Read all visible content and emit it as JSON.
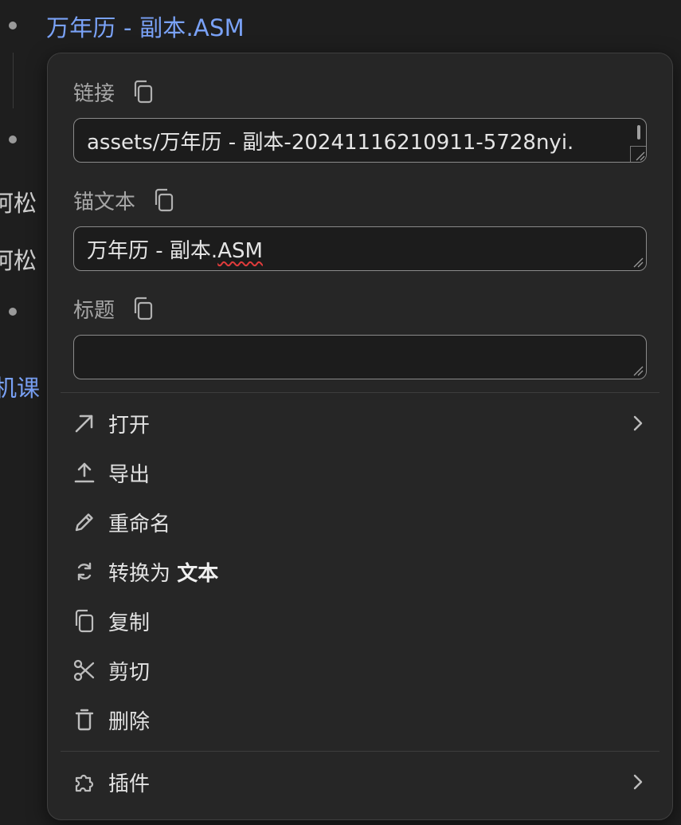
{
  "background": {
    "link_text": "万年历 - 副本.ASM",
    "text_line_1": "呵松",
    "text_line_2": "呵松",
    "text_line_3": "机课"
  },
  "menu": {
    "link_field": {
      "label": "链接",
      "value": "assets/万年历 - 副本-20241116210911-5728nyi."
    },
    "anchor_field": {
      "label": "锚文本",
      "value_prefix": "万年历 - 副本.",
      "value_misspelled": "ASM"
    },
    "title_field": {
      "label": "标题",
      "value": ""
    },
    "items": [
      {
        "label": "打开",
        "icon": "arrow-up-right-icon",
        "has_submenu": true
      },
      {
        "label": "导出",
        "icon": "upload-icon",
        "has_submenu": false
      },
      {
        "label": "重命名",
        "icon": "pencil-icon",
        "has_submenu": false
      },
      {
        "label": "转换为",
        "label_bold": "文本",
        "icon": "refresh-icon",
        "has_submenu": false
      },
      {
        "label": "复制",
        "icon": "copy-icon",
        "has_submenu": false
      },
      {
        "label": "剪切",
        "icon": "scissors-icon",
        "has_submenu": false
      },
      {
        "label": "删除",
        "icon": "trash-icon",
        "has_submenu": false
      },
      {
        "label": "插件",
        "icon": "puzzle-icon",
        "has_submenu": true
      }
    ]
  },
  "colors": {
    "link_blue": "#7aa2f7",
    "menu_bg": "#262626",
    "spellcheck_red": "#e03b3b"
  }
}
